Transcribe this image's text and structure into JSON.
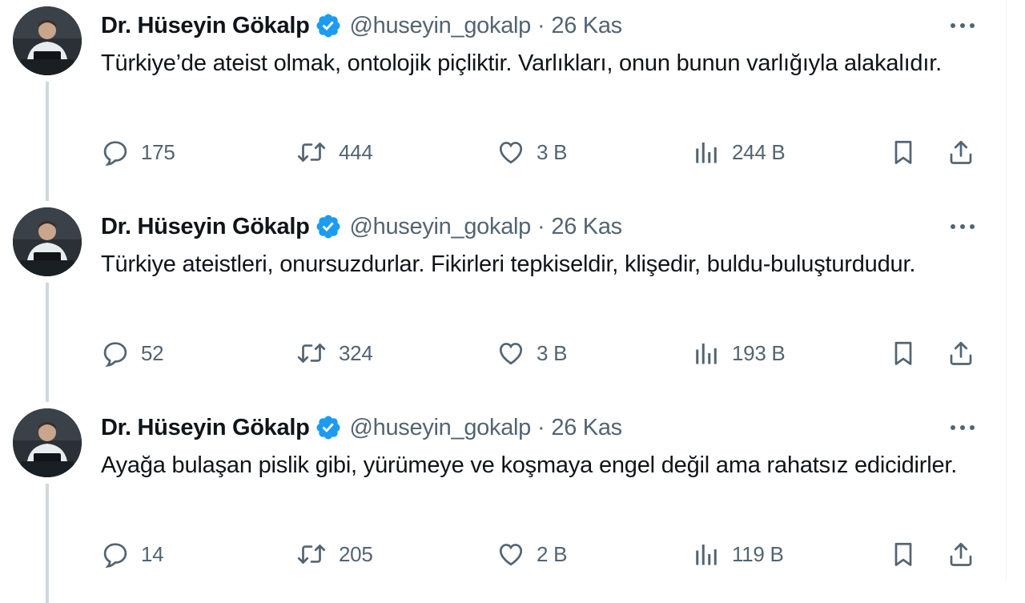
{
  "colors": {
    "text_primary": "#0f1419",
    "text_secondary": "#536471",
    "verified_blue": "#1d9bf0",
    "thread_line": "#cfd9de"
  },
  "icons": {
    "verified": "verified-badge-icon",
    "more": "more-options-icon",
    "reply": "reply-icon",
    "retweet": "retweet-icon",
    "like": "heart-icon",
    "views": "views-bar-chart-icon",
    "bookmark": "bookmark-icon",
    "share": "share-icon"
  },
  "tweets": [
    {
      "author_name": "Dr. Hüseyin Gökalp",
      "handle": "@huseyin_gokalp",
      "separator": "·",
      "date": "26 Kas",
      "text": "Türkiye’de ateist olmak, ontolojik piçliktir. Varlıkları, onun bunun varlığıyla alakalıdır.",
      "replies": "175",
      "retweets": "444",
      "likes": "3 B",
      "views": "244 B"
    },
    {
      "author_name": "Dr. Hüseyin Gökalp",
      "handle": "@huseyin_gokalp",
      "separator": "·",
      "date": "26 Kas",
      "text": "Türkiye ateistleri, onursuzdurlar. Fikirleri tepkiseldir, klişedir, buldu-buluşturdudur.",
      "replies": "52",
      "retweets": "324",
      "likes": "3 B",
      "views": "193 B"
    },
    {
      "author_name": "Dr. Hüseyin Gökalp",
      "handle": "@huseyin_gokalp",
      "separator": "·",
      "date": "26 Kas",
      "text": "Ayağa bulaşan pislik gibi, yürümeye ve koşmaya engel değil ama rahatsız edicidirler.",
      "replies": "14",
      "retweets": "205",
      "likes": "2 B",
      "views": "119 B"
    }
  ]
}
